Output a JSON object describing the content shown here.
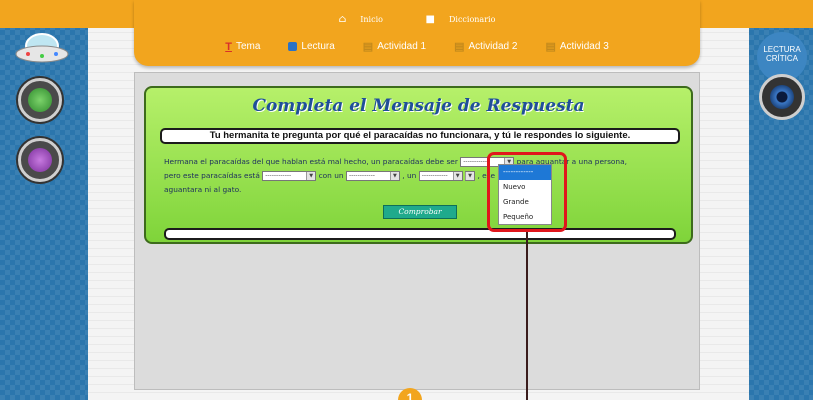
{
  "toplinks": {
    "home_label": "Inicio",
    "dictionary_label": "Diccionario"
  },
  "nav": [
    {
      "label": "Tema",
      "icon": "tema-icon"
    },
    {
      "label": "Lectura",
      "icon": "lectura-icon"
    },
    {
      "label": "Actividad 1",
      "icon": "book-icon"
    },
    {
      "label": "Actividad 2",
      "icon": "book-icon"
    },
    {
      "label": "Actividad 3",
      "icon": "book-icon"
    }
  ],
  "right_badge": {
    "line1": "LECTURA",
    "line2": "CRÍTICA"
  },
  "quiz": {
    "title": "Completa el Mensaje de Respuesta",
    "prompt": "Tu hermanita te pregunta por qué el paracaídas no funcionara, y tú le respondes lo siguiente.",
    "passage": {
      "p1": "Hermana el paracaídas del que hablan está mal hecho, un paracaídas debe ser",
      "p2": "para aguantar a una persona,",
      "p3": "pero este paracaídas está",
      "p4": "con un",
      "p5": ", un",
      "p6": ", ese paracaídas no",
      "p7": "aguantara ni al gato."
    },
    "select_placeholder": "------------",
    "check_button": "Comprobar"
  },
  "dropdown": {
    "options": [
      "------------",
      "Nuevo",
      "Grande",
      "Pequeño"
    ],
    "selected_index": 0
  },
  "bottom_badge": "1",
  "colors": {
    "topbar": "#f2a51e",
    "quiz_bg": "#8ee04c",
    "title": "#1f4f99",
    "highlight": "#e0161c",
    "check_button": "#1faa8c"
  }
}
